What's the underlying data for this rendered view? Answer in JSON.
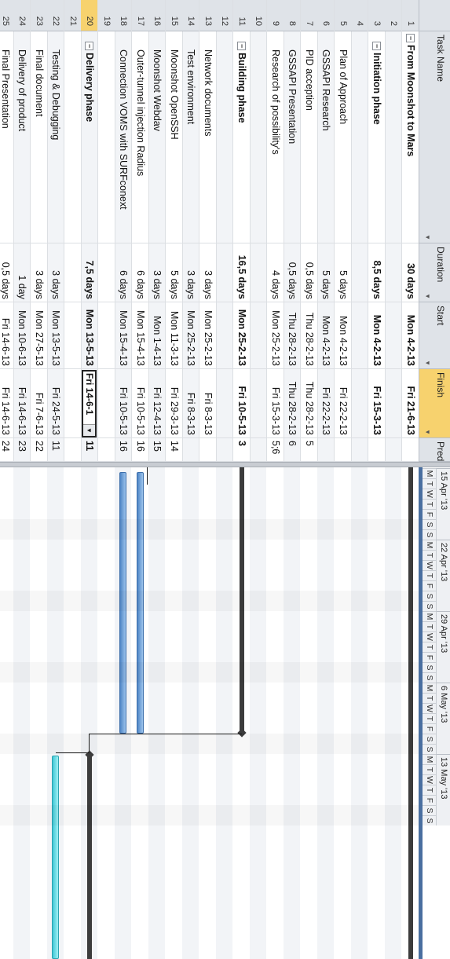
{
  "columns": {
    "task_name": "Task Name",
    "duration": "Duration",
    "start": "Start",
    "finish": "Finish",
    "pred": "Pred"
  },
  "rows": [
    {
      "id": "1",
      "name": "From Moonshot to Mars",
      "duration": "30 days",
      "start": "Mon 4-2-13",
      "finish": "Fri 21-6-13",
      "pred": "",
      "level": 0,
      "bold": true,
      "collapse": true
    },
    {
      "id": "2",
      "name": "",
      "duration": "",
      "start": "",
      "finish": "",
      "pred": "",
      "level": 1
    },
    {
      "id": "3",
      "name": "Initiation phase",
      "duration": "8,5 days",
      "start": "Mon 4-2-13",
      "finish": "Fri 15-3-13",
      "pred": "",
      "level": 1,
      "bold": true,
      "collapse": true
    },
    {
      "id": "4",
      "name": "",
      "duration": "",
      "start": "",
      "finish": "",
      "pred": "",
      "level": 2
    },
    {
      "id": "5",
      "name": "Plan of Approach",
      "duration": "5 days",
      "start": "Mon 4-2-13",
      "finish": "Fri 22-2-13",
      "pred": "",
      "level": 2
    },
    {
      "id": "6",
      "name": "GSSAPI Research",
      "duration": "5 days",
      "start": "Mon 4-2-13",
      "finish": "Fri 22-2-13",
      "pred": "",
      "level": 2
    },
    {
      "id": "7",
      "name": "PID acception",
      "duration": "0,5 days",
      "start": "Thu 28-2-13",
      "finish": "Thu 28-2-13",
      "pred": "5",
      "level": 2
    },
    {
      "id": "8",
      "name": "GSSAPI Presentation",
      "duration": "0,5 days",
      "start": "Thu 28-2-13",
      "finish": "Thu 28-2-13",
      "pred": "6",
      "level": 2
    },
    {
      "id": "9",
      "name": "Research of possibility's",
      "duration": "4 days",
      "start": "Mon 25-2-13",
      "finish": "Fri 15-3-13",
      "pred": "5;6",
      "level": 2
    },
    {
      "id": "10",
      "name": "",
      "duration": "",
      "start": "",
      "finish": "",
      "pred": "",
      "level": 2
    },
    {
      "id": "11",
      "name": "Building phase",
      "duration": "16,5 days",
      "start": "Mon 25-2-13",
      "finish": "Fri 10-5-13",
      "pred": "3",
      "level": 1,
      "bold": true,
      "collapse": true
    },
    {
      "id": "12",
      "name": "",
      "duration": "",
      "start": "",
      "finish": "",
      "pred": "",
      "level": 2
    },
    {
      "id": "13",
      "name": "Network documents",
      "duration": "3 days",
      "start": "Mon 25-2-13",
      "finish": "Fri 8-3-13",
      "pred": "",
      "level": 2
    },
    {
      "id": "14",
      "name": "Test environment",
      "duration": "3 days",
      "start": "Mon 25-2-13",
      "finish": "Fri 8-3-13",
      "pred": "",
      "level": 2
    },
    {
      "id": "15",
      "name": "Moonshot OpenSSH",
      "duration": "5 days",
      "start": "Mon 11-3-13",
      "finish": "Fri 29-3-13",
      "pred": "14",
      "level": 2
    },
    {
      "id": "16",
      "name": "Moonshot Webdav",
      "duration": "3 days",
      "start": "Mon 1-4-13",
      "finish": "Fri 12-4-13",
      "pred": "15",
      "level": 2
    },
    {
      "id": "17",
      "name": "Outer-tunnel injection Radius",
      "duration": "6 days",
      "start": "Mon 15-4-13",
      "finish": "Fri 10-5-13",
      "pred": "16",
      "level": 2
    },
    {
      "id": "18",
      "name": "Connection VOMS with SURFconext",
      "duration": "6 days",
      "start": "Mon 15-4-13",
      "finish": "Fri 10-5-13",
      "pred": "16",
      "level": 2
    },
    {
      "id": "19",
      "name": "",
      "duration": "",
      "start": "",
      "finish": "",
      "pred": "",
      "level": 2
    },
    {
      "id": "20",
      "name": "Delivery phase",
      "duration": "7,5 days",
      "start": "Mon 13-5-13",
      "finish": "Fri 14-6-1",
      "pred": "11",
      "level": 1,
      "bold": true,
      "collapse": true,
      "selected": true
    },
    {
      "id": "21",
      "name": "",
      "duration": "",
      "start": "",
      "finish": "",
      "pred": "",
      "level": 2
    },
    {
      "id": "22",
      "name": "Testing & Debugging",
      "duration": "3 days",
      "start": "Mon 13-5-13",
      "finish": "Fri 24-5-13",
      "pred": "11",
      "level": 2
    },
    {
      "id": "23",
      "name": "Final document",
      "duration": "3 days",
      "start": "Mon 27-5-13",
      "finish": "Fri 7-6-13",
      "pred": "22",
      "level": 2
    },
    {
      "id": "24",
      "name": "Delivery of product",
      "duration": "1 day",
      "start": "Mon 10-6-13",
      "finish": "Fri 14-6-13",
      "pred": "23",
      "level": 2
    },
    {
      "id": "25",
      "name": "Final Presentation",
      "duration": "0,5 days",
      "start": "Fri 14-6-13",
      "finish": "Fri 14-6-13",
      "pred": "24",
      "level": 2
    }
  ],
  "timescale": {
    "weeks": [
      "15 Apr '13",
      "22 Apr '13",
      "29 Apr '13",
      "6 May '13",
      "13 May '13"
    ],
    "day_letters": [
      "M",
      "T",
      "W",
      "T",
      "F",
      "S",
      "S"
    ]
  },
  "colors": {
    "header_bg": "#dfe3e8",
    "selected": "#f7d26e",
    "task_bar": "#4f86c6",
    "delivery_bar": "#3fc8d6",
    "summary_bar": "#3c3c3c"
  }
}
